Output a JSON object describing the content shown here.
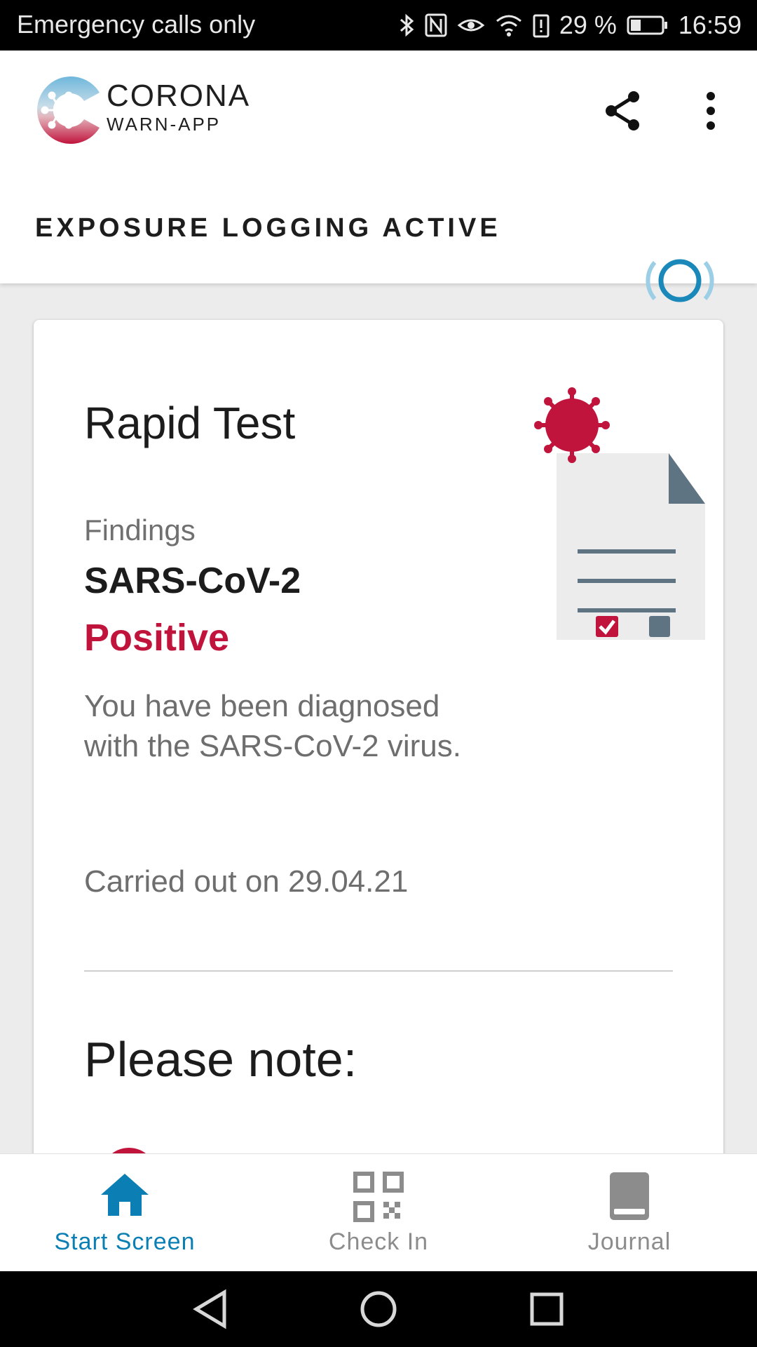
{
  "status_bar": {
    "carrier": "Emergency calls only",
    "battery": "29 %",
    "time": "16:59"
  },
  "header": {
    "logo_line1": "CORONA",
    "logo_line2": "WARN-APP",
    "exposure_status": "EXPOSURE LOGGING ACTIVE"
  },
  "card": {
    "title": "Rapid Test",
    "findings_label": "Findings",
    "virus": "SARS-CoV-2",
    "result": "Positive",
    "description": "You have been diagnosed with the SARS-CoV-2 virus.",
    "carried_out": "Carried out on 29.04.21",
    "note_heading": "Please note:"
  },
  "bottom_nav": {
    "items": [
      {
        "label": "Start Screen",
        "icon": "home-icon",
        "active": true
      },
      {
        "label": "Check In",
        "icon": "qr-code-icon",
        "active": false
      },
      {
        "label": "Journal",
        "icon": "book-icon",
        "active": false
      }
    ]
  },
  "colors": {
    "accent": "#0b7fb3",
    "positive": "#c0143c",
    "inactive": "#8c8c8c"
  }
}
